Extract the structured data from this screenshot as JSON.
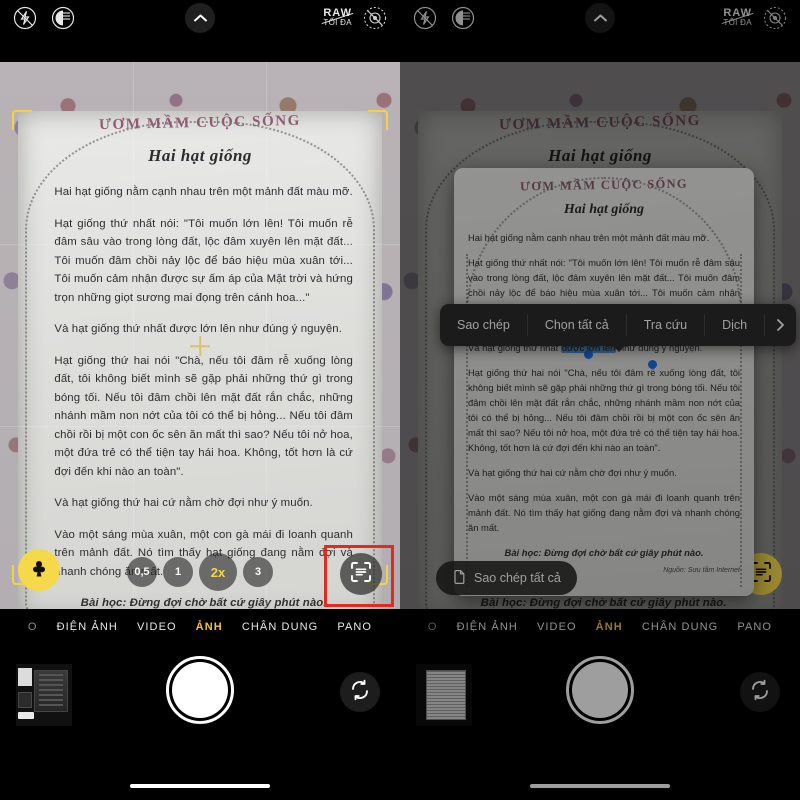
{
  "topbar": {
    "flash_icon": "flash-off-icon",
    "nightmode_icon": "night-mode-icon",
    "chevron_icon": "chevron-up-icon",
    "raw_line1": "RAW",
    "raw_line2": "TỐI ĐA",
    "live_icon": "live-photo-off-icon"
  },
  "document": {
    "banner": "ƯƠM MẦM CUỘC SỐNG",
    "title": "Hai hạt giống",
    "paragraphs": [
      "Hai hạt giống nằm cạnh nhau trên một mảnh đất màu mỡ.",
      "Hạt giống thứ nhất nói: \"Tôi muốn lớn lên! Tôi muốn rễ đâm sâu vào trong lòng đất, lộc đâm xuyên lên mặt đất... Tôi muốn đâm chồi nảy lộc để báo hiệu mùa xuân tới... Tôi muốn cảm nhận được sự ấm áp của Mặt trời và hứng trọn những giọt sương mai đọng trên cánh hoa...\"",
      "Và hạt giống thứ nhất được lớn lên như đúng ý nguyện.",
      "Hạt giống thứ hai nói \"Chà, nếu tôi đâm rễ xuống lòng đất, tôi không biết mình sẽ gặp phải những thứ gì trong bóng tối. Nếu tôi đâm chồi lên mặt đất rắn chắc, những nhánh mầm non nớt của tôi có thể bị hỏng... Nếu tôi đâm chồi rồi bị một con ốc sên ăn mất thì sao? Nếu tôi nở hoa, một đứa trẻ có thể tiện tay hái hoa. Không, tốt hơn là cứ đợi đến khi nào an toàn\".",
      "Và hạt giống thứ hai cứ nằm chờ đợi như ý muốn.",
      "Vào một sáng mùa xuân, một con gà mái đi loanh quanh trên mảnh đất. Nó tìm thấy hạt giống đang nằm đợi và nhanh chóng ăn mất."
    ],
    "moral": "Bài học: Đừng đợi chờ bất cứ giây phút nào.",
    "source": "Nguồn: Sưu tầm Internet",
    "selected_text_prefix": "Và hạt giống thứ nhất ",
    "selected_text": "được lớn lên",
    "selected_text_suffix": " như đúng ý nguyện."
  },
  "controls": {
    "macro_icon": "macro-flower-icon",
    "zoom_levels": [
      {
        "label": "0,5",
        "active": false
      },
      {
        "label": "1",
        "active": false
      },
      {
        "label": "2x",
        "active": true
      },
      {
        "label": "3",
        "active": false
      }
    ],
    "scan_icon": "live-text-scan-icon",
    "scan_highlight_color": "#e02b20",
    "accent_color": "#f5d94a"
  },
  "modes": [
    {
      "label": "ĐIỆN ẢNH",
      "active": false
    },
    {
      "label": "VIDEO",
      "active": false
    },
    {
      "label": "ẢNH",
      "active": true
    },
    {
      "label": "CHÂN DUNG",
      "active": false
    },
    {
      "label": "PANO",
      "active": false
    }
  ],
  "mode_cut_left": "O",
  "shutter": {
    "shutter_label": "shutter-button",
    "flip_icon": "camera-flip-icon",
    "thumbnail_label": "last-photo-thumbnail"
  },
  "context_menu": {
    "items": [
      "Sao chép",
      "Chọn tất cả",
      "Tra cứu",
      "Dịch"
    ],
    "more_icon": "chevron-right-icon"
  },
  "copy_all": {
    "label": "Sao chép tất cả",
    "icon": "copy-document-icon"
  }
}
